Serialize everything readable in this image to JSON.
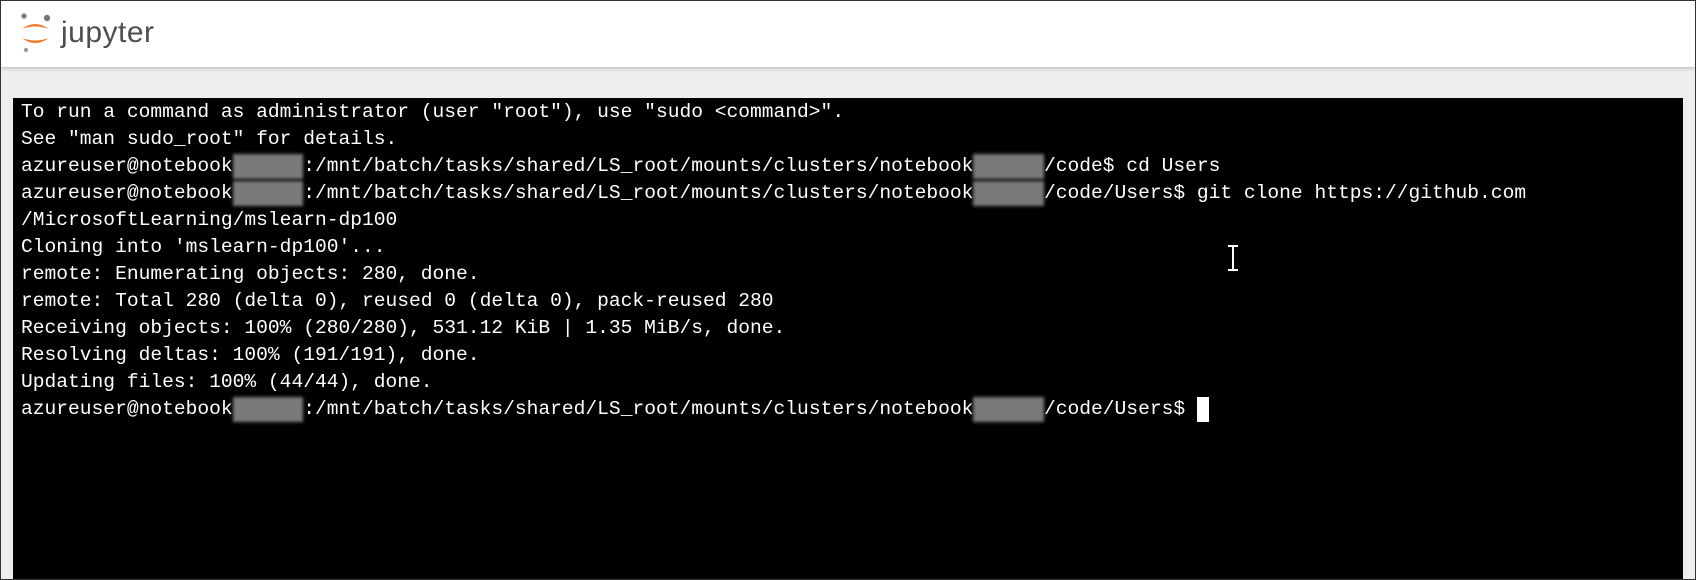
{
  "app": {
    "logo_text": "jupyter",
    "logo_icon": "jupyter-logo-icon"
  },
  "terminal": {
    "lines": [
      {
        "parts": [
          {
            "t": "To run a command as administrator (user \"root\"), use \"sudo <command>\"."
          }
        ]
      },
      {
        "parts": [
          {
            "t": "See \"man sudo_root\" for details."
          }
        ]
      },
      {
        "parts": [
          {
            "t": "azureuser@notebook"
          },
          {
            "r": "311168"
          },
          {
            "t": ":/mnt/batch/tasks/shared/LS_root/mounts/clusters/notebook"
          },
          {
            "r": "311168"
          },
          {
            "t": "/code$ cd Users"
          }
        ]
      },
      {
        "parts": [
          {
            "t": "azureuser@notebook"
          },
          {
            "r": "311168"
          },
          {
            "t": ":/mnt/batch/tasks/shared/LS_root/mounts/clusters/notebook"
          },
          {
            "r": "311168"
          },
          {
            "t": "/code/Users$ git clone https://github.com"
          }
        ]
      },
      {
        "parts": [
          {
            "t": "/MicrosoftLearning/mslearn-dp100"
          }
        ]
      },
      {
        "parts": [
          {
            "t": "Cloning into 'mslearn-dp100'..."
          }
        ]
      },
      {
        "parts": [
          {
            "t": "remote: Enumerating objects: 280, done."
          }
        ]
      },
      {
        "parts": [
          {
            "t": "remote: Total 280 (delta 0), reused 0 (delta 0), pack-reused 280"
          }
        ]
      },
      {
        "parts": [
          {
            "t": "Receiving objects: 100% (280/280), 531.12 KiB | 1.35 MiB/s, done."
          }
        ]
      },
      {
        "parts": [
          {
            "t": "Resolving deltas: 100% (191/191), done."
          }
        ]
      },
      {
        "parts": [
          {
            "t": "Updating files: 100% (44/44), done."
          }
        ]
      },
      {
        "parts": [
          {
            "t": "azureuser@notebook"
          },
          {
            "r": "311168"
          },
          {
            "t": ":/mnt/batch/tasks/shared/LS_root/mounts/clusters/notebook"
          },
          {
            "r": "311168"
          },
          {
            "t": "/code/Users$"
          }
        ],
        "cursor": true
      }
    ],
    "mouse_cursor": "text-ibeam-icon"
  },
  "colors": {
    "terminal_bg": "#000000",
    "terminal_fg": "#ffffff",
    "logo_orange": "#f37726",
    "logo_gray": "#767677"
  }
}
